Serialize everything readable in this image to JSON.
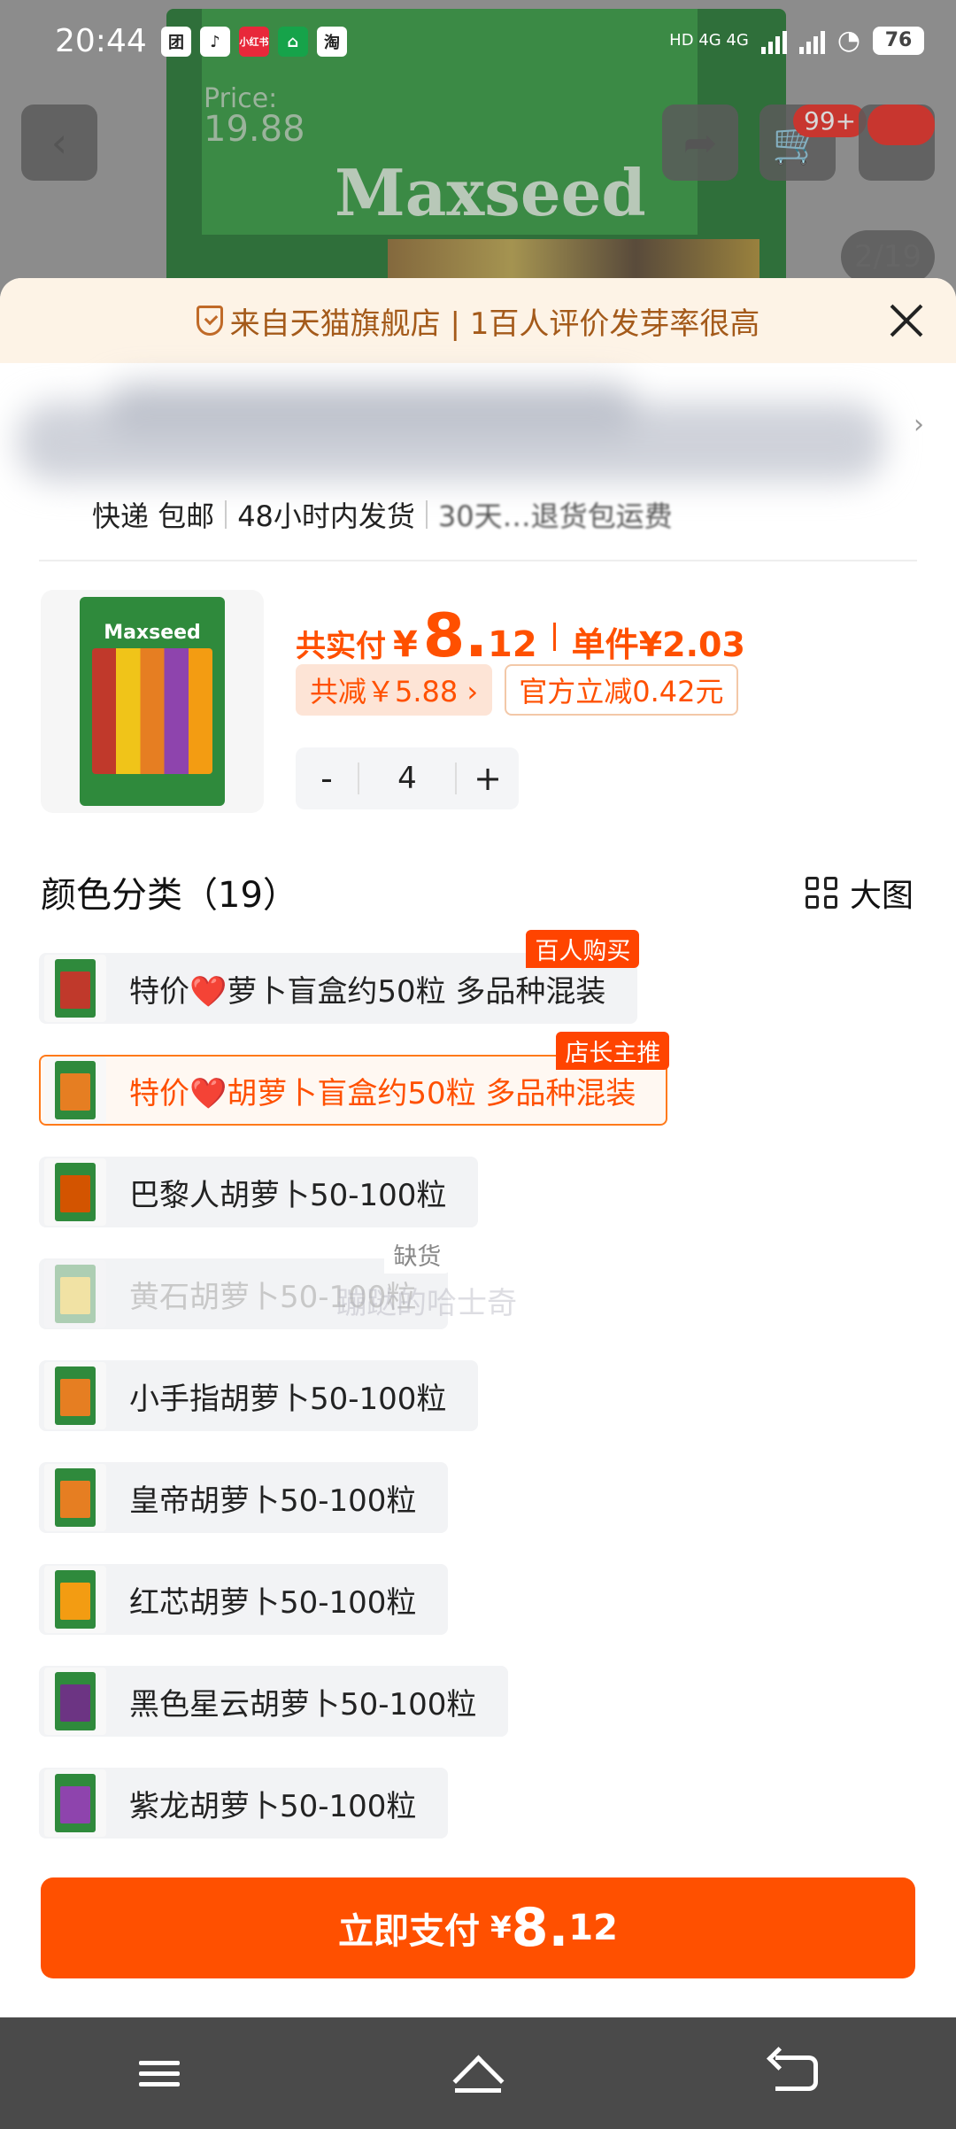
{
  "status_bar": {
    "time": "20:44",
    "apps": [
      "团",
      "♪",
      "小红书",
      "⌂",
      "淘"
    ],
    "network": "HD 4G 4G",
    "battery": "76"
  },
  "header": {
    "bg_price_label": "Price:",
    "bg_price_value": "19.88",
    "bg_brand": "Maxseed",
    "cart_badge": "99+",
    "image_counter": "2/19"
  },
  "banner": {
    "text": "来自天猫旗舰店 | 1百人评价发芽率很高"
  },
  "shipping": {
    "item1": "快递 包邮",
    "item2": "48小时内发货",
    "item3": "30天…退货包运费"
  },
  "product": {
    "thumb_brand": "Maxseed",
    "pay_label": "共实付",
    "currency": "¥",
    "pay_integer": "8.",
    "pay_decimal": "12",
    "unit_label": "单件",
    "unit_price": "¥2.03",
    "discount_tag": "共减￥5.88 ›",
    "official_tag": "官方立减0.42元",
    "quantity": "4",
    "minus": "-",
    "plus": "+"
  },
  "section": {
    "title": "颜色分类（19）",
    "big_image_label": "大图"
  },
  "options": [
    {
      "label": "特价❤️萝卜盲盒约50粒 多品种混装",
      "badge": "百人购买",
      "state": "normal",
      "veg_color": "#c0392b"
    },
    {
      "label": "特价❤️胡萝卜盲盒约50粒 多品种混装",
      "badge": "店长主推",
      "state": "selected",
      "veg_color": "#e67e22"
    },
    {
      "label": "巴黎人胡萝卜50-100粒",
      "badge": "",
      "state": "normal",
      "veg_color": "#d35400"
    },
    {
      "label": "黄石胡萝卜50-100粒",
      "badge": "缺货",
      "state": "soldout",
      "veg_color": "#f1c40f"
    },
    {
      "label": "小手指胡萝卜50-100粒",
      "badge": "",
      "state": "normal",
      "veg_color": "#e67e22"
    },
    {
      "label": "皇帝胡萝卜50-100粒",
      "badge": "",
      "state": "normal",
      "veg_color": "#e67e22"
    },
    {
      "label": "红芯胡萝卜50-100粒",
      "badge": "",
      "state": "normal",
      "veg_color": "#f39c12"
    },
    {
      "label": "黑色星云胡萝卜50-100粒",
      "badge": "",
      "state": "normal",
      "veg_color": "#6c3483"
    },
    {
      "label": "紫龙胡萝卜50-100粒",
      "badge": "",
      "state": "normal",
      "veg_color": "#8e44ad"
    }
  ],
  "watermark": "蹦跶的哈士奇",
  "pay_button": {
    "label": "立即支付",
    "currency": "¥",
    "integer": "8.",
    "decimal": "12"
  },
  "colors": {
    "accent": "#ff5000",
    "banner_bg": "#fdf3e6",
    "selected_border": "#ff7a1a"
  },
  "icons": {
    "back": "back-arrow-icon",
    "share": "share-icon",
    "cart": "cart-icon",
    "more": "more-icon",
    "close": "close-icon",
    "shield": "shield-check-icon",
    "grid": "grid-icon"
  }
}
